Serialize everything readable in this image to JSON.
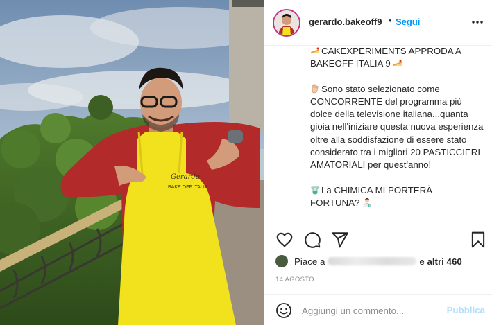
{
  "post": {
    "username": "gerardo.bakeoff9",
    "separator": "•",
    "follow_label": "Segui",
    "caption": {
      "line1": "CAKEXPERIMENTS APPRODA A BAKEOFF ITALIA 9",
      "para2": "Sono stato selezionato come CONCORRENTE del programma più dolce della televisione italiana...quanta gioia nell'iniziare questa nuova esperienza oltre alla soddisfazione di essere stato considerato tra i migliori 20 PASTICCIERI AMATORIALI per quest'anno!",
      "para3": "La CHIMICA MI PORTERÀ FORTUNA?"
    },
    "likes": {
      "prefix": "Piace a",
      "connector": "e",
      "others": "altri 460"
    },
    "date": "14 AGOSTO",
    "comment": {
      "placeholder": "Aggiungi un commento...",
      "publish_label": "Pubblica"
    },
    "apron_text": {
      "name": "Gerardo",
      "show": "BAKE OFF ITALIA"
    }
  },
  "colors": {
    "accent": "#0095f6",
    "publish_disabled": "#b2dffc",
    "apron": "#f2e21e",
    "shirt": "#b32a2a"
  },
  "icons": [
    "more-options-icon",
    "heart-icon",
    "comment-icon",
    "share-icon",
    "bookmark-icon",
    "emoji-icon",
    "cake-slice-icon",
    "raised-hand-icon",
    "test-tube-icon",
    "scientist-icon"
  ]
}
